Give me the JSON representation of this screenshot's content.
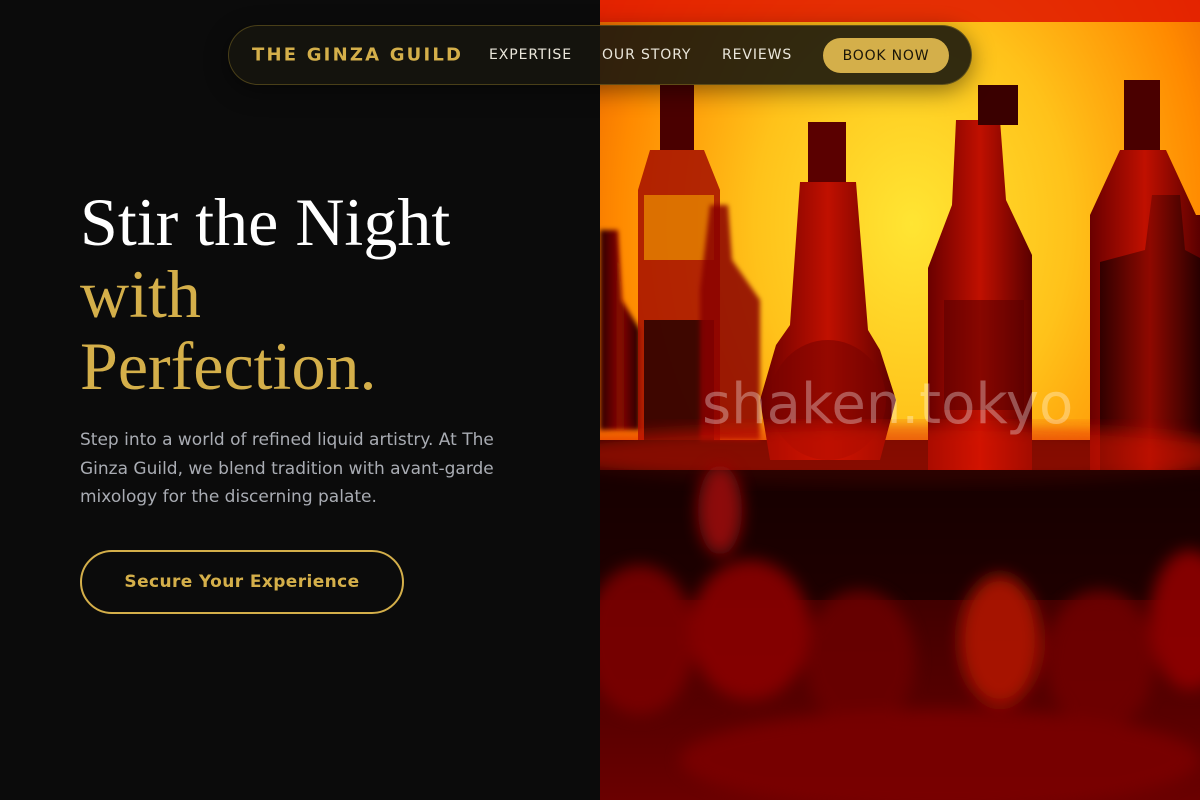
{
  "nav": {
    "brand": "THE GINZA GUILD",
    "links": [
      "EXPERTISE",
      "OUR STORY",
      "REVIEWS"
    ],
    "cta": "BOOK NOW"
  },
  "hero": {
    "title_line1": "Stir the Night",
    "title_line2": "with",
    "title_line3": "Perfection.",
    "description": "Step into a world of refined liquid artistry. At The Ginza Guild, we blend tradition with avant-garde mixology for the discerning palate.",
    "cta": "Secure Your Experience"
  },
  "image": {
    "subject": "bottle-silhouettes-backlit-bar",
    "watermark": "shaken.tokyo"
  },
  "colors": {
    "accent": "#d4af4a",
    "background": "#0b0b0b",
    "body_text": "#a9acb3",
    "heading": "#ffffff"
  }
}
